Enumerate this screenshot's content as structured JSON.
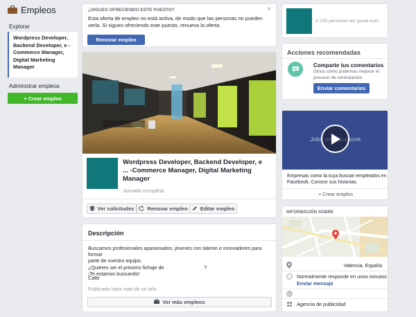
{
  "colors": {
    "accent": "#4267b2",
    "green": "#42b72a",
    "teal": "#10777b",
    "bg": "#e9ebee"
  },
  "left": {
    "title": "Empleos",
    "section_label": "Explorar",
    "job_item": "Wordpress Developer, Backend Developer, e -Commerce Manager, Digital Marketing Manager",
    "manage_label": "Administrar empleos",
    "create_button": "+ Crear empleo"
  },
  "notice": {
    "heading": "¿SIGUES OFRECIENDO ESTE PUESTO?",
    "body": "Esta oferta de empleo no está activa, de modo que las personas no pueden verla. Si sigues ofreciendo este puesto, renueva la oferta.",
    "button": "Renovar empleo",
    "close": "×"
  },
  "job": {
    "title": "Wordpress Developer, Backend Developer, e   ... -Commerce Manager, Digital Marketing Manager",
    "type": "Jornada completa",
    "actions": [
      {
        "icon": "layers-icon",
        "label": "Ver solicitudes"
      },
      {
        "icon": "refresh-icon",
        "label": "Renovar empleo"
      },
      {
        "icon": "pencil-icon",
        "label": "Editar empleo"
      }
    ]
  },
  "description": {
    "heading": "Descripción",
    "lines": [
      "Buscamos profesionales apasionados, jóvenes con talento e innovadores para formar",
      "parte de nuestro equipo.",
      "¿Quieres ser el próximo fichaje de                             ?",
      "¡Te estamos buscando!"
    ],
    "street": "Calle",
    "published": "Publicado hace más de un año",
    "more_button": "Ver más empleos"
  },
  "page": {
    "likes": "A 732 personas les gusta esto"
  },
  "recommended": {
    "heading": "Acciones recomendadas",
    "item_title": "Comparte tus comentarios",
    "item_body": "Dinos cómo podemos mejorar el proceso de contratación.",
    "button": "Enviar comentarios"
  },
  "video": {
    "caption": "Jobs on Facebook",
    "text": "Empresas como la tuya buscan empleados en Facebook. Conoce sus historias.",
    "create": "+ Crear empleo"
  },
  "about": {
    "heading": "INFORMACIÓN SOBRE",
    "location": "Valencia, España",
    "response": "Normalmente responde en unos minutos",
    "send_message": "Enviar mensaje",
    "category": "Agencia de publicidad"
  }
}
